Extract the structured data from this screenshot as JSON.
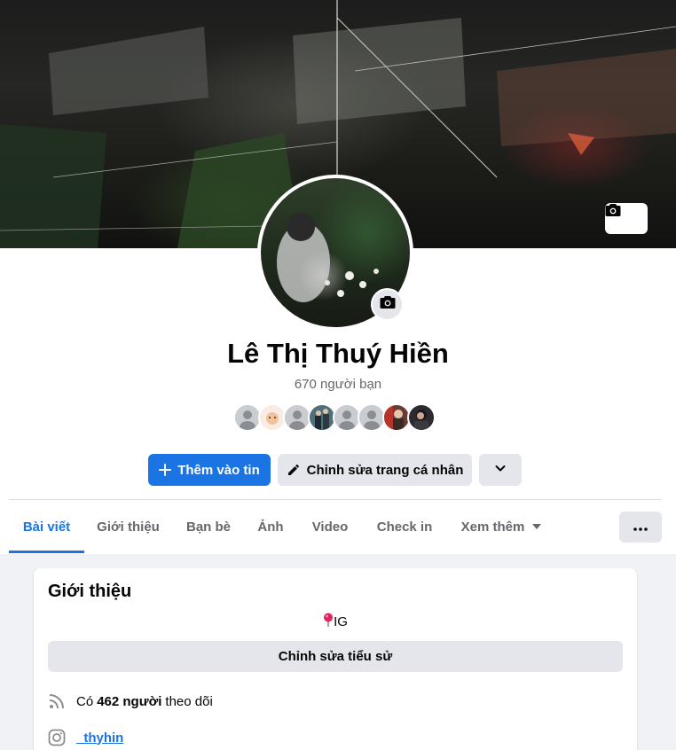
{
  "profile": {
    "name": "Lê Thị Thuý Hiền",
    "friends_count": "670 người bạn"
  },
  "actions": {
    "add_story_label": "Thêm vào tin",
    "edit_profile_label": "Chỉnh sửa trang cá nhân"
  },
  "tabs": [
    {
      "label": "Bài viết",
      "active": true
    },
    {
      "label": "Giới thiệu",
      "active": false
    },
    {
      "label": "Bạn bè",
      "active": false
    },
    {
      "label": "Ảnh",
      "active": false
    },
    {
      "label": "Video",
      "active": false
    },
    {
      "label": "Check in",
      "active": false
    },
    {
      "label": "Xem thêm",
      "active": false
    }
  ],
  "intro": {
    "title": "Giới thiệu",
    "bio": "IG",
    "edit_bio_label": "Chỉnh sửa tiểu sử",
    "followers_prefix": "Có",
    "followers_count": "462 người",
    "followers_suffix": "theo dõi",
    "instagram_handle": "_thyhin"
  },
  "colors": {
    "accent": "#1b74e4",
    "secondary_button": "#e4e6eb",
    "page_background": "#f0f2f5"
  },
  "icons": {
    "cover_camera": "camera-icon",
    "avatar_camera": "camera-icon",
    "add_story": "plus-icon",
    "edit_profile": "pencil-icon",
    "more": "chevron-down-icon",
    "tab_more": "caret-down-icon",
    "options": "ellipsis-icon",
    "bio_pin": "round-pushpin-icon",
    "followers": "rss-icon",
    "instagram": "instagram-icon"
  }
}
